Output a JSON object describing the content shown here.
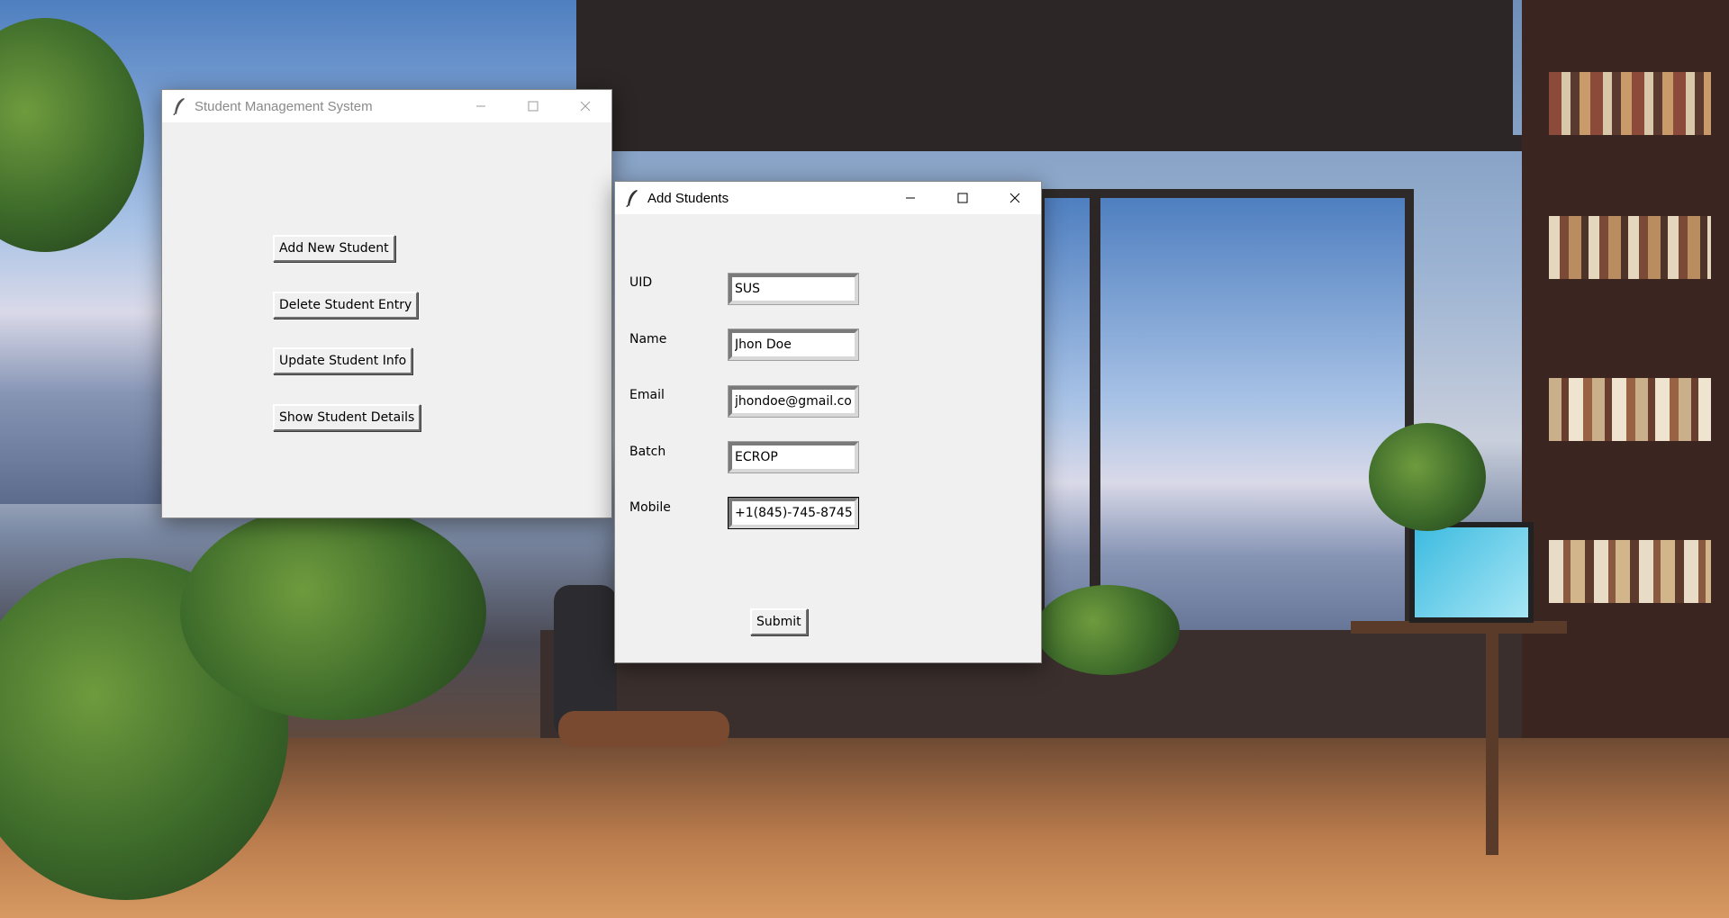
{
  "main_window": {
    "title": "Student Management System",
    "buttons": {
      "add": "Add New Student",
      "delete": "Delete Student Entry",
      "update": "Update Student Info",
      "show": "Show Student Details"
    }
  },
  "add_window": {
    "title": "Add Students",
    "fields": {
      "uid": {
        "label": "UID",
        "value": "SUS"
      },
      "name": {
        "label": "Name",
        "value": "Jhon Doe"
      },
      "email": {
        "label": "Email",
        "value": "jhondoe@gmail.com"
      },
      "batch": {
        "label": "Batch",
        "value": "ECROP"
      },
      "mobile": {
        "label": "Mobile",
        "value": "+1(845)-745-8745"
      }
    },
    "submit_label": "Submit"
  },
  "icons": {
    "app": "feather-icon",
    "minimize": "minimize-icon",
    "maximize": "maximize-icon",
    "close": "close-icon"
  },
  "colors": {
    "window_bg": "#f0f0f0",
    "titlebar_bg": "#ffffff"
  }
}
